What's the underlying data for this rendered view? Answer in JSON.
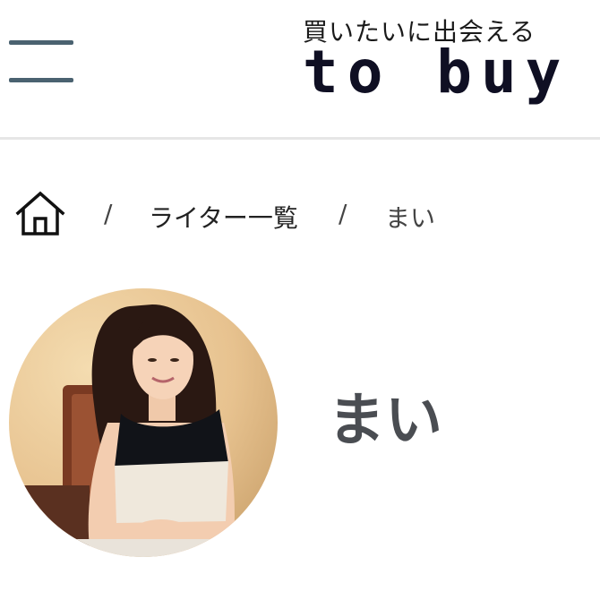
{
  "header": {
    "tagline": "買いたいに出会える",
    "logo_text": "to buy",
    "menu_icon": "hamburger-menu-icon"
  },
  "breadcrumb": {
    "home_icon": "home-icon",
    "separator": "/",
    "items": [
      {
        "label": "ライター一覧"
      },
      {
        "label": "まい"
      }
    ]
  },
  "profile": {
    "name": "まい"
  },
  "colors": {
    "menu_bar": "#4a6270",
    "logo": "#0f0f23",
    "name_text": "#4a4d52",
    "divider": "#e6e6e6"
  }
}
